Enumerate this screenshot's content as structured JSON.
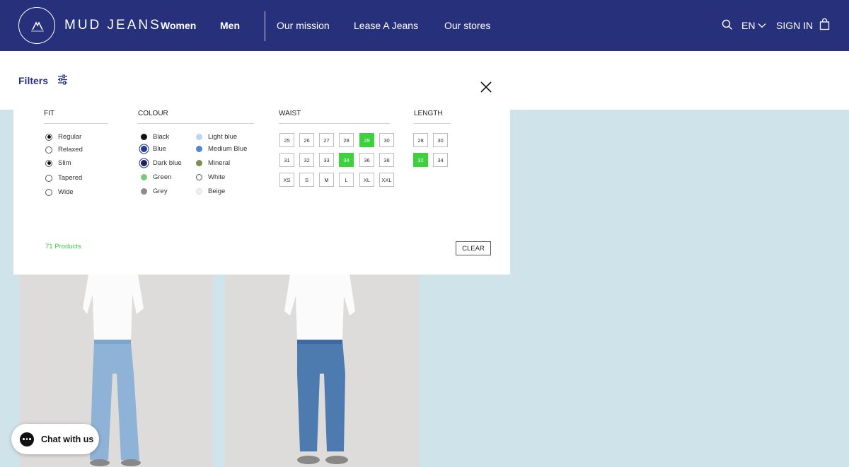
{
  "header": {
    "brand": "MUD JEANS",
    "seal_text": "MUD JEANS",
    "nav_main": [
      "Women",
      "Men"
    ],
    "nav_secondary": [
      "Our mission",
      "Lease A Jeans",
      "Our stores"
    ],
    "language": "EN",
    "signin": "SIGN IN",
    "icons": [
      "search-icon",
      "chevron-down-icon",
      "bag-icon"
    ]
  },
  "filters": {
    "label": "Filters",
    "fit": {
      "title": "FIT",
      "options": [
        {
          "label": "Regular",
          "selected": true
        },
        {
          "label": "Relaxed",
          "selected": false
        },
        {
          "label": "Slim",
          "selected": true
        },
        {
          "label": "Tapered",
          "selected": false
        },
        {
          "label": "Wide",
          "selected": false
        }
      ]
    },
    "colour": {
      "title": "COLOUR",
      "options": [
        {
          "label": "Black",
          "color": "#111111",
          "selected": false
        },
        {
          "label": "Blue",
          "color": "#1f3fa0",
          "selected": true
        },
        {
          "label": "Dark blue",
          "color": "#1a2560",
          "selected": true
        },
        {
          "label": "Green",
          "color": "#7ec77e",
          "selected": false
        },
        {
          "label": "Grey",
          "color": "#8d8d8d",
          "selected": false
        },
        {
          "label": "Light blue",
          "color": "#bcd6f0",
          "selected": false
        },
        {
          "label": "Medium Blue",
          "color": "#4d86d6",
          "selected": false
        },
        {
          "label": "Mineral",
          "color": "#7e8c52",
          "selected": false
        },
        {
          "label": "White",
          "color": "#ffffff",
          "selected": false
        },
        {
          "label": "Beige",
          "color": "#efefef",
          "selected": false
        }
      ]
    },
    "waist": {
      "title": "WAIST",
      "sizes": [
        "25",
        "26",
        "27",
        "28",
        "29",
        "30",
        "31",
        "32",
        "33",
        "34",
        "36",
        "38",
        "XS",
        "S",
        "M",
        "L",
        "XL",
        "XXL"
      ],
      "selected": [
        "29",
        "34"
      ]
    },
    "length": {
      "title": "LENGTH",
      "sizes": [
        "28",
        "30",
        "32",
        "34"
      ],
      "selected": [
        "32"
      ]
    },
    "products_count": "71 Products",
    "clear_label": "CLEAR"
  },
  "chat": {
    "label": "Chat with us"
  },
  "colors": {
    "header": "#27307a",
    "accent_green": "#3ed13e",
    "page_bg": "#cfe4ea"
  }
}
